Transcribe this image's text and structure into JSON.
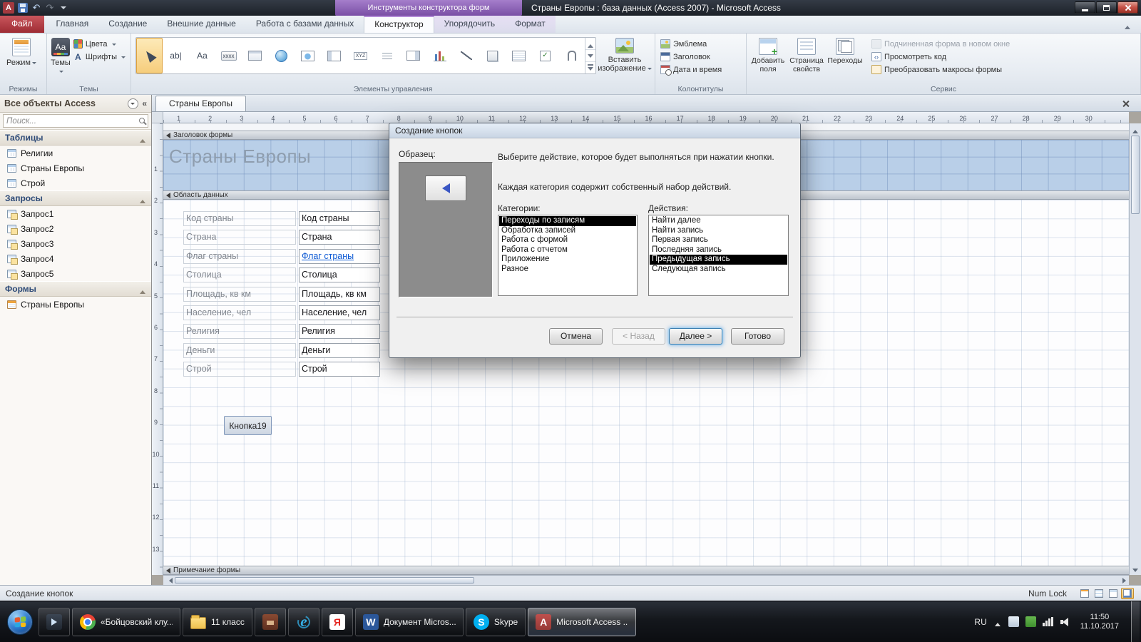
{
  "titlebar": {
    "context_group": "Инструменты конструктора форм",
    "title": "Страны Европы : база данных (Access 2007)  -  Microsoft Access"
  },
  "ribbon": {
    "tabs": [
      {
        "label": "Файл",
        "file": true
      },
      {
        "label": "Главная"
      },
      {
        "label": "Создание"
      },
      {
        "label": "Внешние данные"
      },
      {
        "label": "Работа с базами данных"
      },
      {
        "label": "Конструктор",
        "active": true,
        "contextual": true
      },
      {
        "label": "Упорядочить",
        "contextual": true
      },
      {
        "label": "Формат",
        "contextual": true
      }
    ],
    "views": {
      "label": "Режимы",
      "button": "Режим"
    },
    "themes": {
      "label": "Темы",
      "button": "Темы",
      "colors": "Цвета",
      "fonts": "Шрифты"
    },
    "controls": {
      "label": "Элементы управления",
      "insert_image": "Вставить изображение"
    },
    "controls_gallery": [
      {
        "name": "select-tool",
        "glyph": "",
        "selected": true
      },
      {
        "name": "text-box-control",
        "glyph": "ab|"
      },
      {
        "name": "label-control",
        "glyph": "Aa"
      },
      {
        "name": "button-control",
        "glyph": "xxxx"
      },
      {
        "name": "tab-control",
        "glyph": ""
      },
      {
        "name": "hyperlink-control",
        "glyph": ""
      },
      {
        "name": "web-browser-control",
        "glyph": ""
      },
      {
        "name": "navigation-control",
        "glyph": ""
      },
      {
        "name": "option-group-control",
        "glyph": "XYZ"
      },
      {
        "name": "page-break-control",
        "glyph": ""
      },
      {
        "name": "combo-box-control",
        "glyph": ""
      },
      {
        "name": "chart-control",
        "glyph": ""
      },
      {
        "name": "line-control",
        "glyph": ""
      },
      {
        "name": "toggle-button-control",
        "glyph": ""
      },
      {
        "name": "list-box-control",
        "glyph": ""
      },
      {
        "name": "check-box-control",
        "glyph": ""
      },
      {
        "name": "attachment-control",
        "glyph": ""
      }
    ],
    "header_footer": {
      "label": "Колонтитулы",
      "items": [
        {
          "label": "Эмблема",
          "icon": "logo"
        },
        {
          "label": "Заголовок",
          "icon": "title"
        },
        {
          "label": "Дата и время",
          "icon": "datetime"
        }
      ]
    },
    "tools": {
      "label": "Сервис",
      "big": [
        {
          "label": "Добавить поля",
          "icon": "add-fields"
        },
        {
          "label": "Страница свойств",
          "icon": "property-sheet"
        },
        {
          "label": "Переходы",
          "icon": "tab-order"
        }
      ],
      "small": [
        {
          "label": "Подчиненная форма в новом окне",
          "icon": "subform",
          "disabled": true
        },
        {
          "label": "Просмотреть код",
          "icon": "view-code"
        },
        {
          "label": "Преобразовать макросы формы",
          "icon": "convert-macros"
        }
      ]
    }
  },
  "nav": {
    "title": "Все объекты Access",
    "search_placeholder": "Поиск...",
    "sections": [
      {
        "label": "Таблицы",
        "items": [
          {
            "label": "Религии",
            "icon": "table"
          },
          {
            "label": "Страны Европы",
            "icon": "table"
          },
          {
            "label": "Строй",
            "icon": "table"
          }
        ]
      },
      {
        "label": "Запросы",
        "items": [
          {
            "label": "Запрос1",
            "icon": "query"
          },
          {
            "label": "Запрос2",
            "icon": "query"
          },
          {
            "label": "Запрос3",
            "icon": "query"
          },
          {
            "label": "Запрос4",
            "icon": "query"
          },
          {
            "label": "Запрос5",
            "icon": "query"
          }
        ]
      },
      {
        "label": "Формы",
        "items": [
          {
            "label": "Страны Европы",
            "icon": "form"
          }
        ]
      }
    ]
  },
  "document": {
    "tab": "Страны Европы",
    "form_title": "Страны Европы",
    "sections": {
      "header": "Заголовок формы",
      "detail": "Область данных",
      "footer": "Примечание формы"
    },
    "fields": [
      {
        "label": "Код страны",
        "value": "Код страны"
      },
      {
        "label": "Страна",
        "value": "Страна"
      },
      {
        "label": "Флаг страны",
        "value": "Флаг страны",
        "link": true
      },
      {
        "label": "Столица",
        "value": "Столица"
      },
      {
        "label": "Площадь, кв км",
        "value": "Площадь, кв км"
      },
      {
        "label": "Население, чел",
        "value": "Население, чел"
      },
      {
        "label": "Религия",
        "value": "Религия"
      },
      {
        "label": "Деньги",
        "value": "Деньги"
      },
      {
        "label": "Строй",
        "value": "Строй"
      }
    ],
    "button_label": "Кнопка19",
    "ruler_h": [
      1,
      2,
      3,
      4,
      5,
      6,
      7,
      8,
      9,
      10,
      11,
      12,
      13,
      14,
      15,
      16,
      17,
      18,
      19,
      20,
      21,
      22,
      23,
      24,
      25,
      26,
      27,
      28,
      29,
      30
    ],
    "ruler_v": [
      1,
      2,
      3,
      4,
      5,
      6,
      7,
      8,
      9,
      10,
      11,
      12,
      13
    ]
  },
  "dialog": {
    "title": "Создание кнопок",
    "sample_label": "Образец:",
    "instruction1": "Выберите действие, которое будет выполняться при нажатии кнопки.",
    "instruction2": "Каждая категория содержит собственный набор действий.",
    "categories_label": "Категории:",
    "actions_label": "Действия:",
    "categories": [
      {
        "label": "Переходы по записям",
        "selected": true
      },
      {
        "label": "Обработка записей"
      },
      {
        "label": "Работа с формой"
      },
      {
        "label": "Работа с отчетом"
      },
      {
        "label": "Приложение"
      },
      {
        "label": "Разное"
      }
    ],
    "actions": [
      {
        "label": "Найти далее"
      },
      {
        "label": "Найти запись"
      },
      {
        "label": "Первая запись"
      },
      {
        "label": "Последняя запись"
      },
      {
        "label": "Предыдущая запись",
        "selected": true
      },
      {
        "label": "Следующая запись"
      }
    ],
    "buttons": [
      {
        "label": "Отмена"
      },
      {
        "label": "< Назад",
        "disabled": true
      },
      {
        "label": "Далее >",
        "default": true
      },
      {
        "label": "Готово"
      }
    ]
  },
  "statusbar": {
    "left": "Создание кнопок",
    "right": "Num Lock"
  },
  "taskbar": {
    "items": [
      {
        "icon": "media",
        "label": ""
      },
      {
        "icon": "chrome",
        "label": "«Бойцовский клу..."
      },
      {
        "icon": "folder",
        "label": "11 класс"
      },
      {
        "icon": "game",
        "label": ""
      },
      {
        "icon": "ie",
        "label": ""
      },
      {
        "icon": "yandex",
        "label": ""
      },
      {
        "icon": "word",
        "label": "Документ Micros..."
      },
      {
        "icon": "skype",
        "label": "Skype"
      },
      {
        "icon": "access",
        "label": "Microsoft Access ...",
        "active": true
      }
    ],
    "tray": {
      "lang": "RU",
      "time": "11:50",
      "date": "11.10.2017"
    }
  }
}
